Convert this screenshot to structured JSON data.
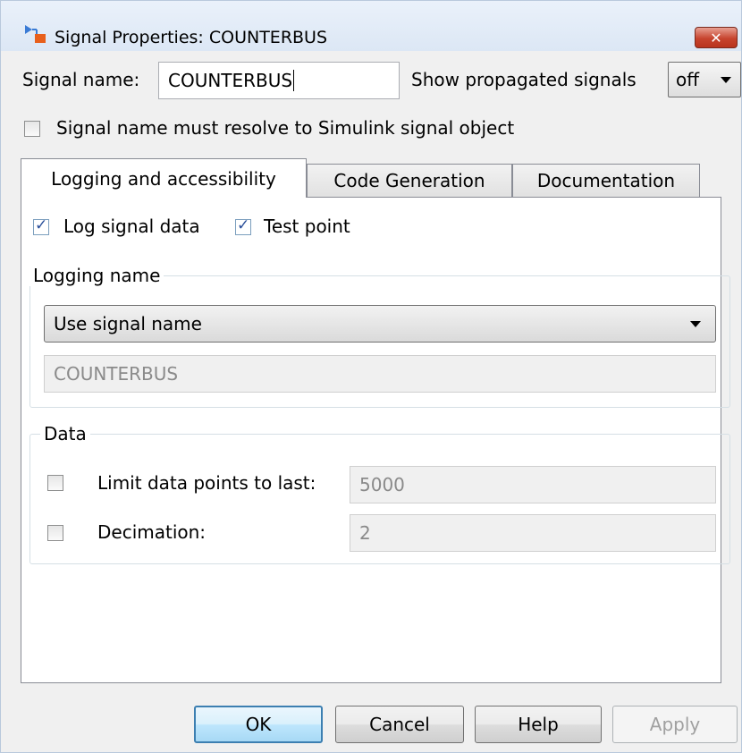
{
  "window": {
    "title": "Signal Properties: COUNTERBUS",
    "icon": "simulink-signal-icon",
    "close_label": "✕"
  },
  "signal_name": {
    "label": "Signal name:",
    "value": "COUNTERBUS"
  },
  "propagated": {
    "label": "Show propagated signals",
    "value": "off"
  },
  "resolve": {
    "label": "Signal name must resolve to Simulink signal object",
    "checked": false
  },
  "tabs": [
    {
      "label": "Logging and accessibility",
      "active": true
    },
    {
      "label": "Code Generation",
      "active": false
    },
    {
      "label": "Documentation",
      "active": false
    }
  ],
  "logging": {
    "log_signal_data_label": "Log signal data",
    "log_signal_data_checked": true,
    "test_point_label": "Test point",
    "test_point_checked": true,
    "group_title": "Logging name",
    "name_mode": "Use signal name",
    "name_value": "COUNTERBUS"
  },
  "data": {
    "group_title": "Data",
    "limit_label": "Limit data points to last:",
    "limit_checked": false,
    "limit_value": "5000",
    "decimation_label": "Decimation:",
    "decimation_checked": false,
    "decimation_value": "2"
  },
  "buttons": {
    "ok": "OK",
    "cancel": "Cancel",
    "help": "Help",
    "apply": "Apply"
  },
  "colors": {
    "tick": "#2a4f9a",
    "close": "#c7442e",
    "default_button_border": "#3c7fb1"
  }
}
